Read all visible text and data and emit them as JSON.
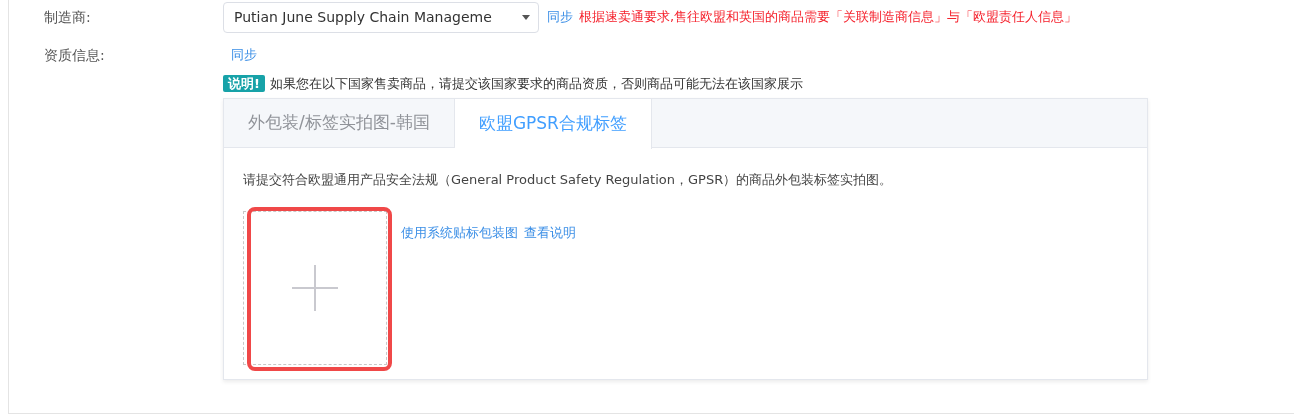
{
  "manufacturer_row": {
    "label": "制造商:",
    "select_value": "Putian June Supply Chain Manageme",
    "sync_link": "同步",
    "warning": "根据速卖通要求,售往欧盟和英国的商品需要「关联制造商信息」与「欧盟责任人信息」"
  },
  "qualification_row": {
    "label": "资质信息:",
    "sync_link": "同步"
  },
  "notice": {
    "badge": "说明!",
    "text": "如果您在以下国家售卖商品，请提交该国家要求的商品资质，否则商品可能无法在该国家展示"
  },
  "tabs": [
    {
      "label": "外包装/标签实拍图-韩国",
      "selected": false
    },
    {
      "label": "欧盟GPSR合规标签",
      "selected": true
    }
  ],
  "tab_panel": {
    "description": "请提交符合欧盟通用产品安全法规（General Product Safety Regulation，GPSR）的商品外包装标签实拍图。",
    "upload_highlighted": true,
    "links": [
      "使用系统贴标包装图",
      "查看说明"
    ]
  }
}
